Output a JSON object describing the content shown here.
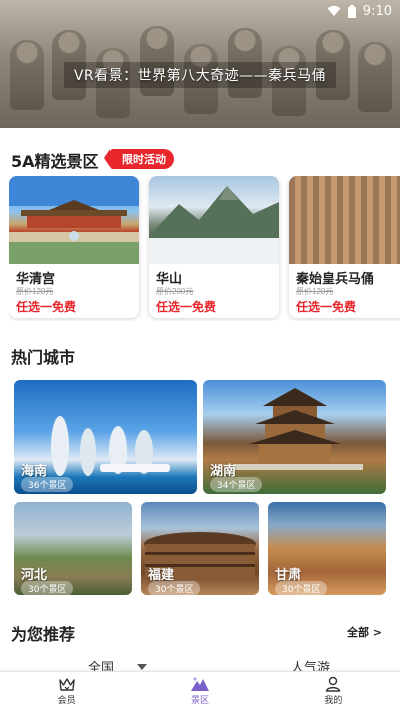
{
  "status_bar": {
    "time": "9:10"
  },
  "banner": {
    "caption": "VR看景：世界第八大奇迹——秦兵马俑"
  },
  "section_5a": {
    "title": "5A精选景区",
    "badge": "限时活动"
  },
  "scenic_cards": [
    {
      "name": "华清宫",
      "original_price": "原价120元",
      "offer": "任选一免费"
    },
    {
      "name": "华山",
      "original_price": "原价200元",
      "offer": "任选一免费"
    },
    {
      "name": "秦始皇兵马俑",
      "original_price": "原价120元",
      "offer": "任选一免费"
    }
  ],
  "hot_cities": {
    "title": "热门城市",
    "items": [
      {
        "name": "海南",
        "count": "36个景区"
      },
      {
        "name": "湖南",
        "count": "34个景区"
      },
      {
        "name": "河北",
        "count": "30个景区"
      },
      {
        "name": "福建",
        "count": "30个景区"
      },
      {
        "name": "甘肃",
        "count": "30个景区"
      }
    ]
  },
  "recommend": {
    "title": "为您推荐",
    "see_all": "全部 >",
    "filters": [
      "全国",
      "人气游"
    ]
  },
  "bottom_nav": [
    {
      "label": "会员",
      "icon": "crown-icon",
      "active": false
    },
    {
      "label": "景区",
      "icon": "mountain-icon",
      "active": true
    },
    {
      "label": "我的",
      "icon": "person-icon",
      "active": false
    }
  ],
  "colors": {
    "accent_red": "#e8262b",
    "nav_active": "#7b5fc9"
  }
}
